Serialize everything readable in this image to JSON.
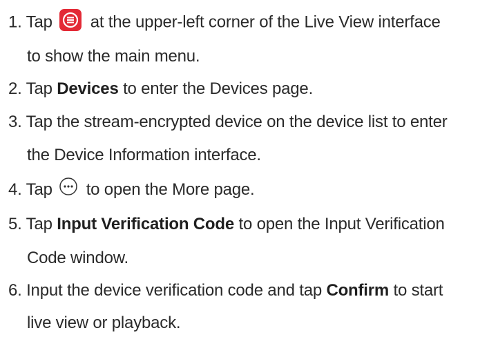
{
  "steps": [
    {
      "number": "1.",
      "lines": [
        {
          "pre": "Tap",
          "icon": "menu-icon",
          "post": "at the upper-left corner of the Live View interface"
        },
        {
          "text": "to show the main menu."
        }
      ]
    },
    {
      "number": "2.",
      "pre": "Tap",
      "bold": "Devices",
      "post": "to enter the Devices page."
    },
    {
      "number": "3.",
      "line1": "Tap the stream-encrypted device on the device list to enter",
      "line2": "the Device Information interface."
    },
    {
      "number": "4.",
      "pre": "Tap",
      "icon": "more-icon",
      "post": "to open the More page."
    },
    {
      "number": "5.",
      "pre": "Tap",
      "bold": "Input Verification Code",
      "post": "to open the Input Verification",
      "line2": "Code window."
    },
    {
      "number": "6.",
      "pre": "Input the device verification code and tap",
      "bold": "Confirm",
      "post": "to start",
      "line2": "live view or playback."
    }
  ],
  "colors": {
    "text": "#2a2a2a",
    "menu_icon_bg": "#e32a36"
  }
}
